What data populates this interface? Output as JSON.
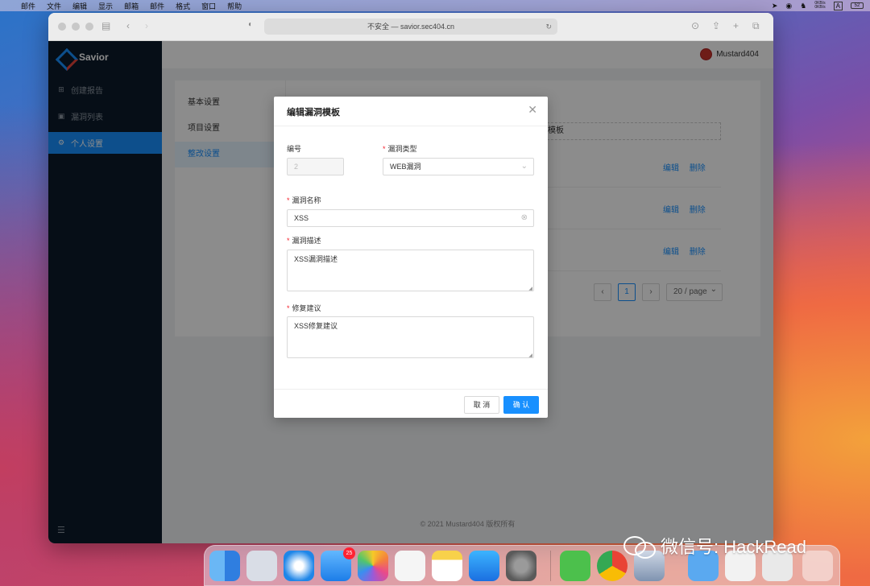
{
  "menubar": {
    "apple": "",
    "items": [
      "邮件",
      "文件",
      "编辑",
      "显示",
      "邮箱",
      "邮件",
      "格式",
      "窗口",
      "帮助"
    ],
    "net_up": "0KB/s",
    "net_down": "0KB/s",
    "input": "A",
    "battery": "52"
  },
  "browser": {
    "url": "不安全 — savior.sec404.cn"
  },
  "app": {
    "name": "Savior",
    "user": "Mustard404",
    "sidebar": [
      {
        "label": "创建报告",
        "icon": "plus-square-icon"
      },
      {
        "label": "漏洞列表",
        "icon": "file-search-icon"
      },
      {
        "label": "个人设置",
        "icon": "gear-icon"
      }
    ],
    "tabs": [
      "基本设置",
      "项目设置",
      "整改设置"
    ],
    "template_text": "模板",
    "row_edit": "编辑",
    "row_delete": "删除",
    "page_current": "1",
    "page_size": "20 / page",
    "footer": "© 2021 Mustard404 版权所有"
  },
  "modal": {
    "title": "编辑漏洞模板",
    "id_label": "编号",
    "id_value": "2",
    "type_label": "漏洞类型",
    "type_value": "WEB漏洞",
    "name_label": "漏洞名称",
    "name_value": "XSS",
    "desc_label": "漏洞描述",
    "desc_value": "XSS漏洞描述",
    "fix_label": "修复建议",
    "fix_value": "XSS修复建议",
    "cancel": "取 消",
    "ok": "确 认"
  },
  "dock": {
    "mail_badge": "25",
    "apps": [
      "finder",
      "launchpad",
      "safari",
      "mail",
      "photos",
      "reminders",
      "notes",
      "app-store",
      "system-preferences",
      "wechat",
      "chrome",
      "preview",
      "downloads",
      "files",
      "screenshot",
      "trash"
    ]
  },
  "watermark": "微信号: HackRead"
}
